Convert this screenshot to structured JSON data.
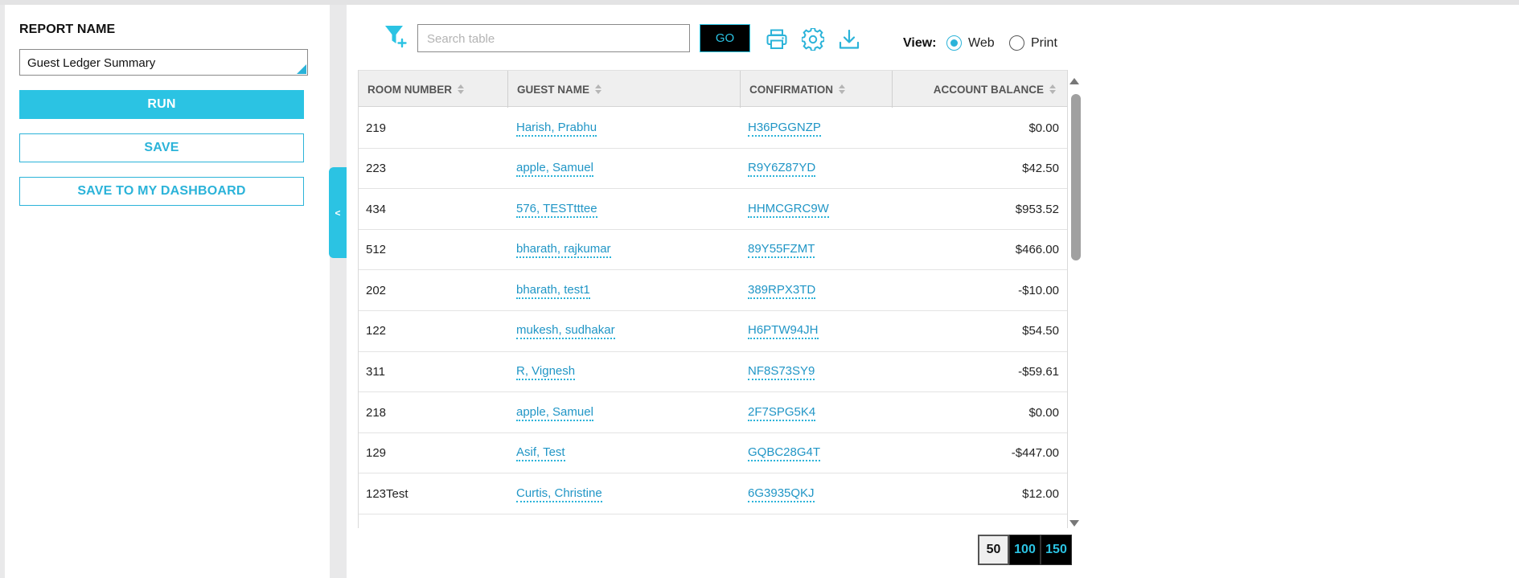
{
  "sidebar": {
    "report_name_label": "REPORT NAME",
    "report_name_value": "Guest Ledger Summary",
    "run_label": "RUN",
    "save_label": "SAVE",
    "save_dashboard_label": "SAVE TO MY DASHBOARD",
    "collapse_glyph": "<"
  },
  "toolbar": {
    "search_placeholder": "Search table",
    "go_label": "GO",
    "icons": [
      "filter-add-icon",
      "print-icon",
      "gear-icon",
      "download-icon"
    ],
    "view_label": "View:",
    "view_options": [
      {
        "label": "Web",
        "selected": true
      },
      {
        "label": "Print",
        "selected": false
      }
    ]
  },
  "table": {
    "columns": [
      "ROOM NUMBER",
      "GUEST NAME",
      "CONFIRMATION",
      "ACCOUNT BALANCE"
    ],
    "rows": [
      {
        "room": "219",
        "guest": "Harish, Prabhu",
        "confirmation": "H36PGGNZP",
        "balance": "$0.00"
      },
      {
        "room": "223",
        "guest": "apple, Samuel",
        "confirmation": "R9Y6Z87YD",
        "balance": "$42.50"
      },
      {
        "room": "434",
        "guest": "576, TESTtttee",
        "confirmation": "HHMCGRC9W",
        "balance": "$953.52"
      },
      {
        "room": "512",
        "guest": "bharath, rajkumar",
        "confirmation": "89Y55FZMT",
        "balance": "$466.00"
      },
      {
        "room": "202",
        "guest": "bharath, test1",
        "confirmation": "389RPX3TD",
        "balance": "-$10.00"
      },
      {
        "room": "122",
        "guest": "mukesh, sudhakar",
        "confirmation": "H6PTW94JH",
        "balance": "$54.50"
      },
      {
        "room": "311",
        "guest": "R, Vignesh",
        "confirmation": "NF8S73SY9",
        "balance": "-$59.61"
      },
      {
        "room": "218",
        "guest": "apple, Samuel",
        "confirmation": "2F7SPG5K4",
        "balance": "$0.00"
      },
      {
        "room": "129",
        "guest": "Asif, Test",
        "confirmation": "GQBC28G4T",
        "balance": "-$447.00"
      },
      {
        "room": "123Test",
        "guest": "Curtis, Christine",
        "confirmation": "6G3935QKJ",
        "balance": "$12.00"
      }
    ]
  },
  "pagination": {
    "options": [
      "50",
      "100",
      "150"
    ],
    "selected": "50"
  },
  "colors": {
    "accent": "#2bc3e3",
    "link": "#2196c6"
  }
}
